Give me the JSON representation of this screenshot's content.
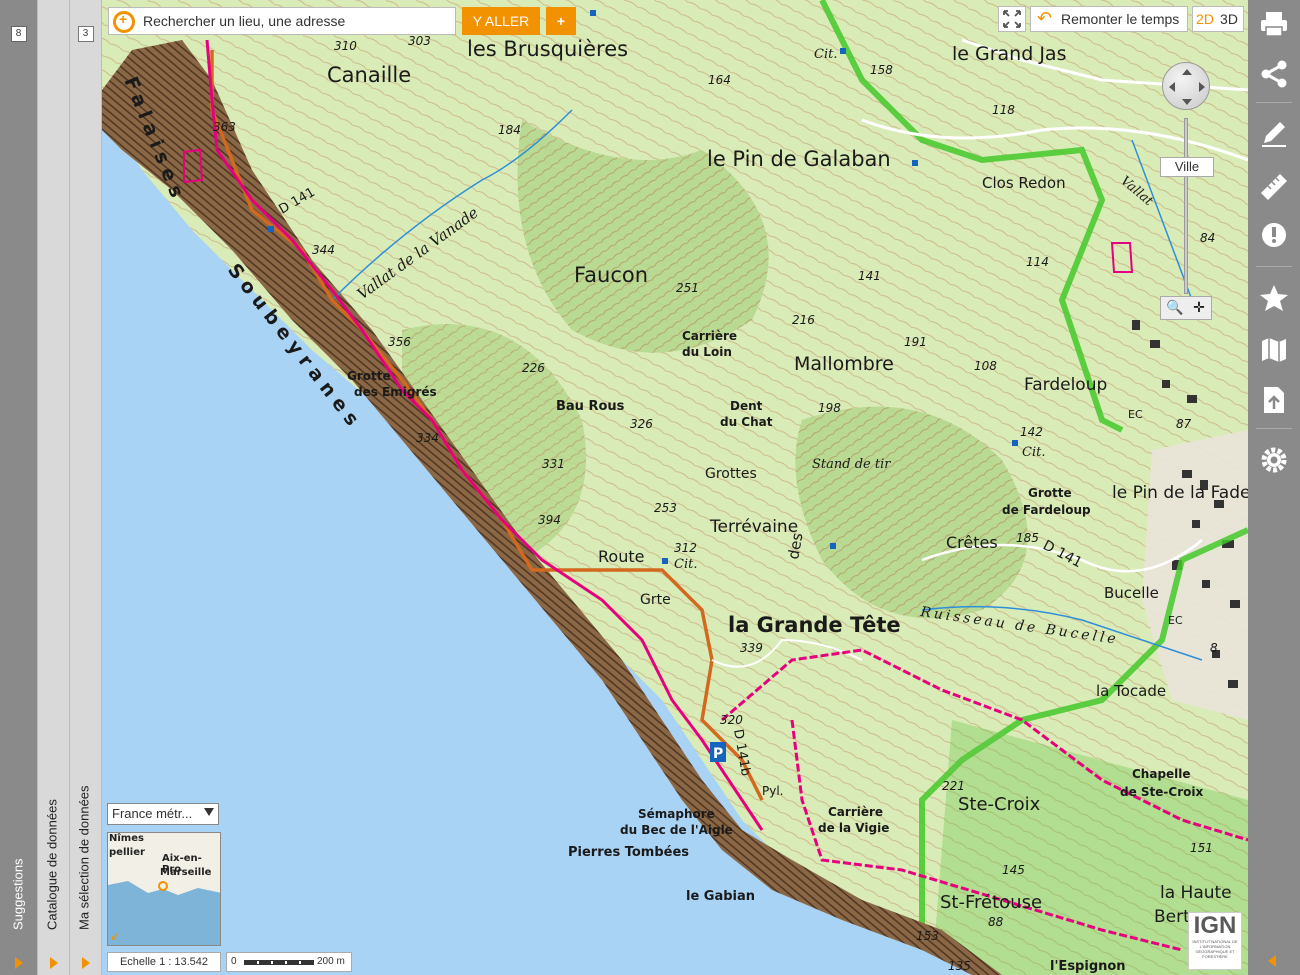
{
  "left_panels": {
    "suggestions": {
      "label": "Suggestions",
      "count": "8"
    },
    "catalogue": {
      "label": "Catalogue de données"
    },
    "selection": {
      "label": "Ma sélection de données",
      "count": "3"
    }
  },
  "search": {
    "placeholder": "Rechercher un lieu, une adresse",
    "go_label": "Y ALLER",
    "plus_label": "+"
  },
  "top_controls": {
    "time_label": "Remonter le temps",
    "mode_2d": "2D",
    "mode_3d": "3D"
  },
  "navigation": {
    "zoom_level_label": "Ville"
  },
  "overview": {
    "layer_select": "France métr...",
    "places": [
      "Nîmes",
      "pellier",
      "Aix-en-Pro",
      "Marseille"
    ]
  },
  "scale": {
    "ratio": "Echelle 1 : 13.542",
    "start": "0",
    "end": "200 m"
  },
  "logo": {
    "text": "IGN",
    "subtitle": "INSTITUT NATIONAL DE L'INFORMATION GÉOGRAPHIQUE ET FORESTIÈRE"
  },
  "colors": {
    "accent": "#f39200",
    "sea": "#a9d3f5",
    "land": "#d9ecb7",
    "forest": "#a6cf82",
    "trail": "#e6007e",
    "road": "#d2691e",
    "toolbar": "#8a8a8a"
  },
  "toolbar_icons": [
    "print-icon",
    "share-icon",
    "pencil-icon",
    "ruler-icon",
    "alert-icon",
    "star-icon",
    "map-icon",
    "upload-icon",
    "gear-icon"
  ],
  "map_labels": {
    "les_brusquieres": "les Brusquières",
    "canaille": "Canaille",
    "le_grand_jas": "le Grand Jas",
    "le_pin_de_galaban": "le Pin de Galaban",
    "clos_redon": "Clos Redon",
    "vallat_de_la_vanade": "Vallat de la Vanade",
    "faucon": "Faucon",
    "carriere_du_loin_1": "Carrière",
    "carriere_du_loin_2": "du Loin",
    "mallombre": "Mallombre",
    "fardeloup": "Fardeloup",
    "falaises": "Falaises",
    "soubeyranes": "Soubeyranes",
    "grotte_emigres_1": "Grotte",
    "grotte_emigres_2": "des Emigrés",
    "bau_rous": "Bau Rous",
    "dent_du_chat_1": "Dent",
    "dent_du_chat_2": "du Chat",
    "stand_de_tir": "Stand de tir",
    "grottes": "Grottes",
    "grotte_fardeloup_1": "Grotte",
    "grotte_fardeloup_2": "de Fardeloup",
    "le_pin_de_la_fade": "le Pin de la Fade",
    "terrevaine": "Terrévaine",
    "cretes": "Crêtes",
    "d141_east": "D 141",
    "route": "Route",
    "grte": "Grte",
    "la_grande_tete": "la Grande Tête",
    "ruisseau_de_bucelle": "Ruisseau de Bucelle",
    "bucelle": "Bucelle",
    "la_tocade": "la Tocade",
    "d141b": "D 141b",
    "pyl": "Pyl.",
    "semaphore_1": "Sémaphore",
    "semaphore_2": "du Bec de l'Aigle",
    "pierres_tombees": "Pierres Tombées",
    "le_gabian": "le Gabian",
    "carriere_vigie_1": "Carrière",
    "carriere_vigie_2": "de la Vigie",
    "ste_croix": "Ste-Croix",
    "chapelle_1": "Chapelle",
    "chapelle_2": "de Ste-Croix",
    "st_fretouse": "St-Frétouse",
    "la_haute": "la Haute",
    "bertr": "Bertr",
    "l_espignon": "l'Espignon",
    "d141_north": "D 141",
    "vallat_east": "Vallat",
    "cit": "Cit.",
    "ec": "EC",
    "des": "des",
    "alt_310": "310",
    "alt_303": "303",
    "alt_363": "363",
    "alt_184": "184",
    "alt_164": "164",
    "alt_158": "158",
    "alt_118": "118",
    "alt_344": "344",
    "alt_356": "356",
    "alt_251": "251",
    "alt_216": "216",
    "alt_141": "141",
    "alt_114": "114",
    "alt_84": "84",
    "alt_226": "226",
    "alt_191": "191",
    "alt_108": "108",
    "alt_326": "326",
    "alt_198": "198",
    "alt_142": "142",
    "alt_87": "87",
    "alt_334": "334",
    "alt_331": "331",
    "alt_394": "394",
    "alt_253": "253",
    "alt_312": "312",
    "alt_185": "185",
    "alt_339": "339",
    "alt_320": "320",
    "alt_221": "221",
    "alt_151": "151",
    "alt_145": "145",
    "alt_88": "88",
    "alt_153": "153",
    "alt_135": "135",
    "alt_8": "8"
  }
}
